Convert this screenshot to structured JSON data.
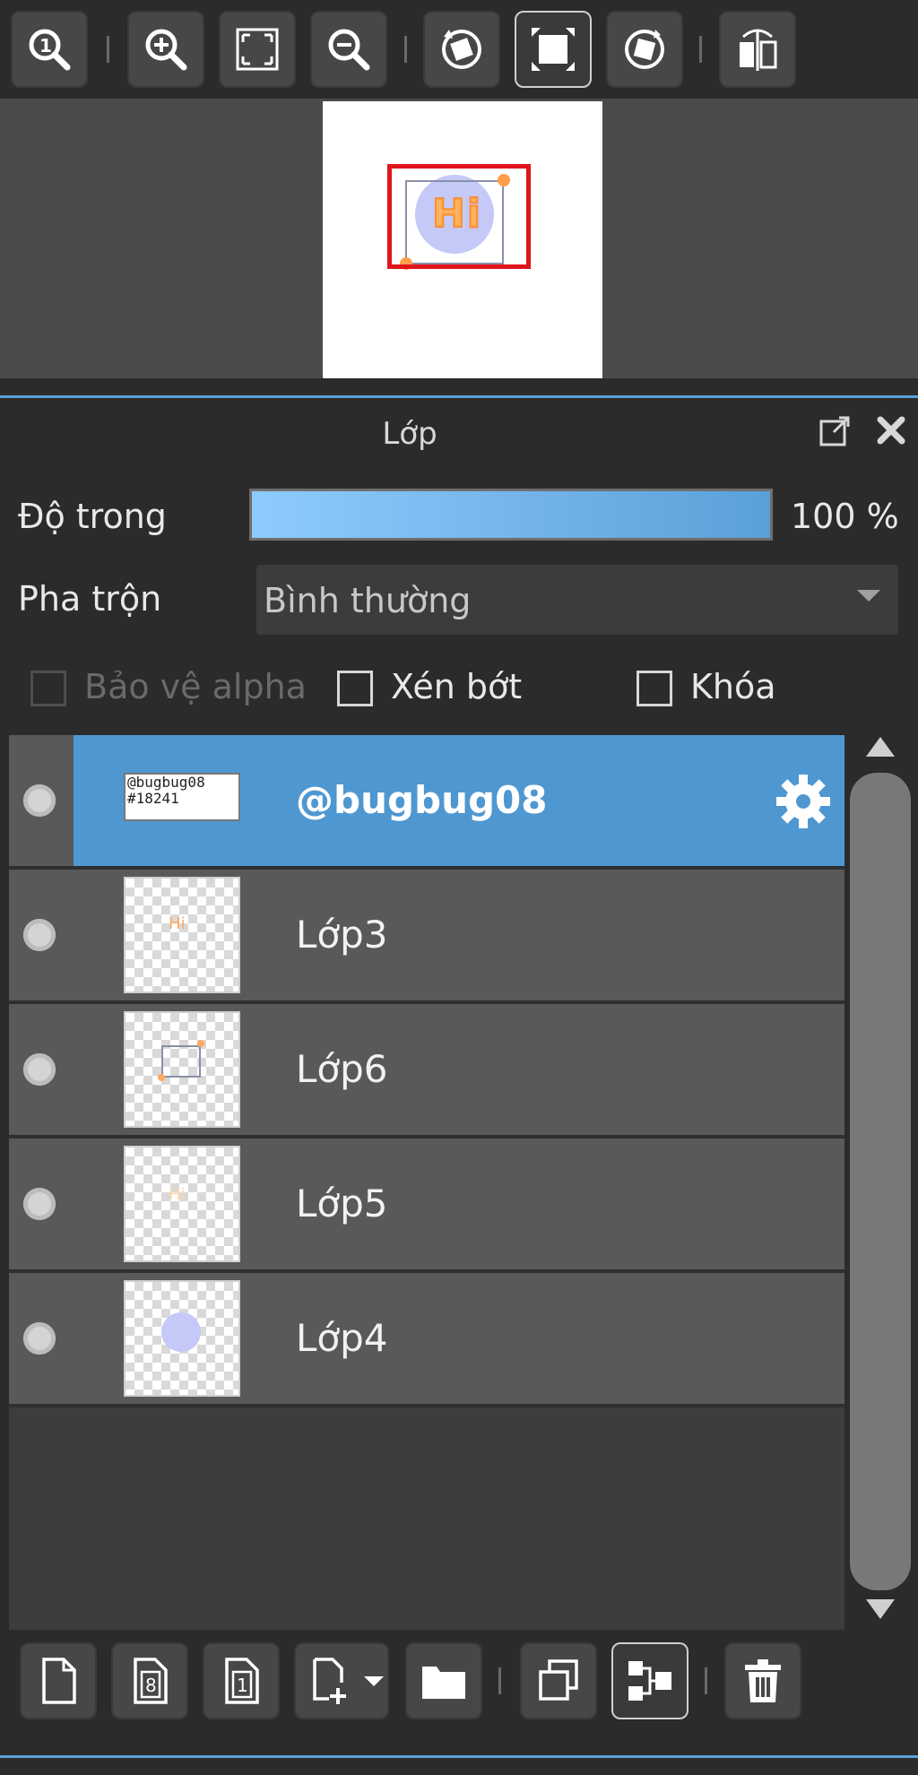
{
  "toolbar": {
    "buttons": [
      "zoom-actual-size",
      "zoom-in",
      "fit-to-window",
      "zoom-out",
      "rotate-left",
      "fullscreen",
      "rotate-reset",
      "flip-horizontal"
    ]
  },
  "navigator": {
    "preview_text": "Hi"
  },
  "panel": {
    "title": "Lớp",
    "opacity_label": "Độ trong",
    "opacity_value": "100 %",
    "opacity_fraction": 1.0,
    "blend_label": "Pha trộn",
    "blend_value": "Bình thường",
    "protect_alpha_label": "Bảo vệ alpha",
    "clipping_label": "Xén bớt",
    "lock_label": "Khóa"
  },
  "layers": [
    {
      "name": "@bugbug08",
      "thumb_text": "@bugbug08\n#18241",
      "selected": true
    },
    {
      "name": "Lớp3",
      "thumb_text": "Hi",
      "selected": false
    },
    {
      "name": "Lớp6",
      "thumb_text": "",
      "selected": false
    },
    {
      "name": "Lớp5",
      "thumb_text": "Hi",
      "selected": false
    },
    {
      "name": "Lớp4",
      "thumb_text": "",
      "selected": false
    }
  ],
  "colors": {
    "accent": "#5aa2dc",
    "selected_row": "#4f97d0",
    "viewport_rect": "#e0151b"
  }
}
